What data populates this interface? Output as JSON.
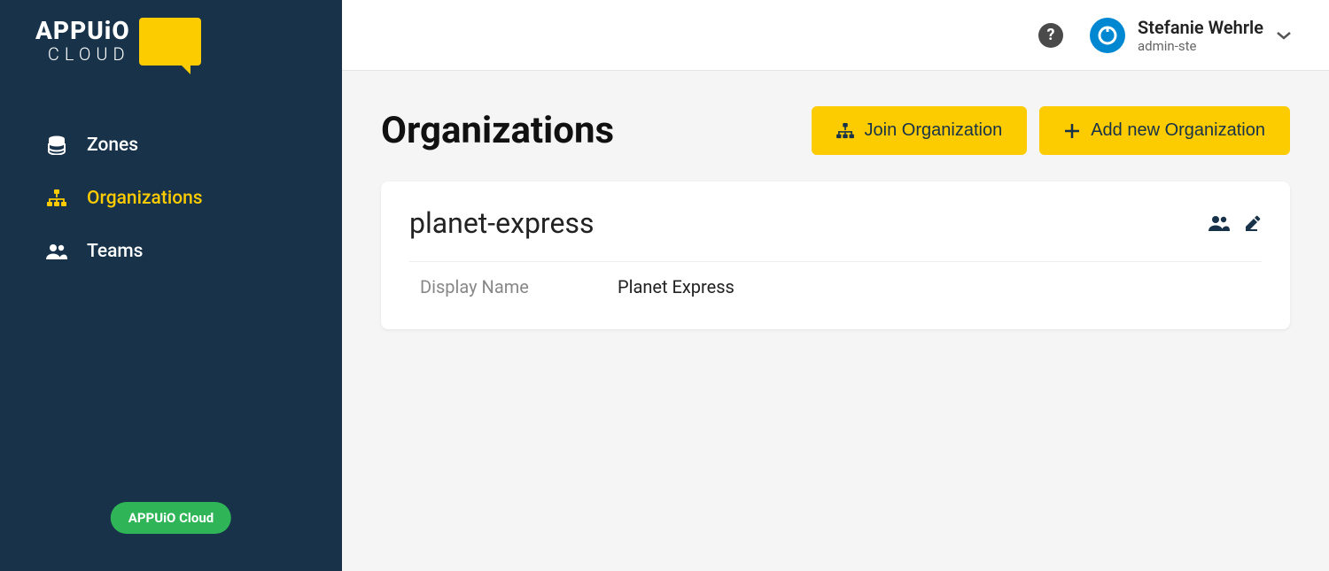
{
  "brand": {
    "name_top": "APPUiO",
    "name_bottom": "CLOUD"
  },
  "sidebar": {
    "items": [
      {
        "label": "Zones",
        "icon": "database-icon",
        "active": false
      },
      {
        "label": "Organizations",
        "icon": "sitemap-icon",
        "active": true
      },
      {
        "label": "Teams",
        "icon": "users-icon",
        "active": false
      }
    ],
    "badge": "APPUiO Cloud"
  },
  "topbar": {
    "user_name": "Stefanie Wehrle",
    "user_handle": "admin-ste"
  },
  "page": {
    "title": "Organizations",
    "join_label": "Join Organization",
    "add_label": "Add new Organization"
  },
  "org": {
    "name": "planet-express",
    "display_name_label": "Display Name",
    "display_name_value": "Planet Express"
  }
}
